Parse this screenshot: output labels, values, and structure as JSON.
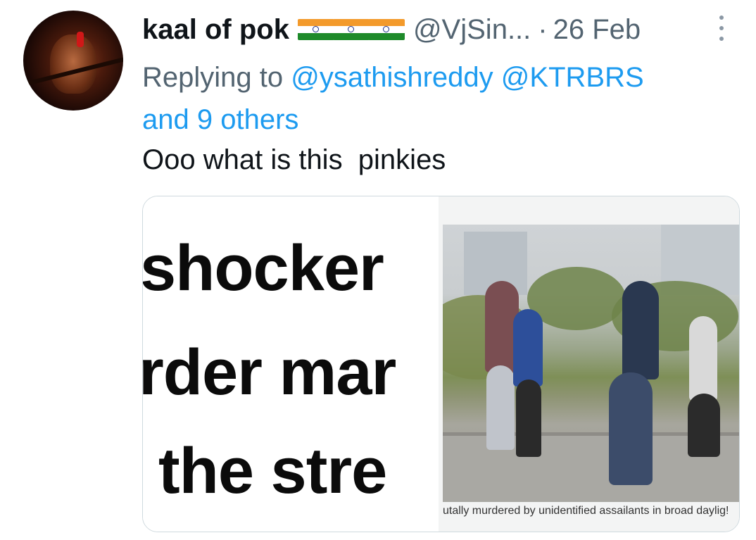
{
  "tweet": {
    "display_name": "kaal of pok",
    "flags": [
      "flag-india-icon",
      "flag-india-icon",
      "flag-india-icon"
    ],
    "handle": "@VjSin...",
    "separator": "·",
    "date": "26 Feb",
    "replying_to_prefix": "Replying to",
    "mentions": [
      "@ysathishreddy",
      "@KTRBRS"
    ],
    "others": "and 9 others",
    "text": "Ooo what is this  pinkies"
  },
  "media": {
    "left_headline": [
      "shocker",
      "rder mar",
      "the stre"
    ],
    "right_caption": "utally murdered by unidentified assailants in broad daylig!"
  },
  "colors": {
    "link": "#1d9bf0",
    "secondary_text": "#536471",
    "primary_text": "#0f1419",
    "border": "#cfd9de"
  }
}
